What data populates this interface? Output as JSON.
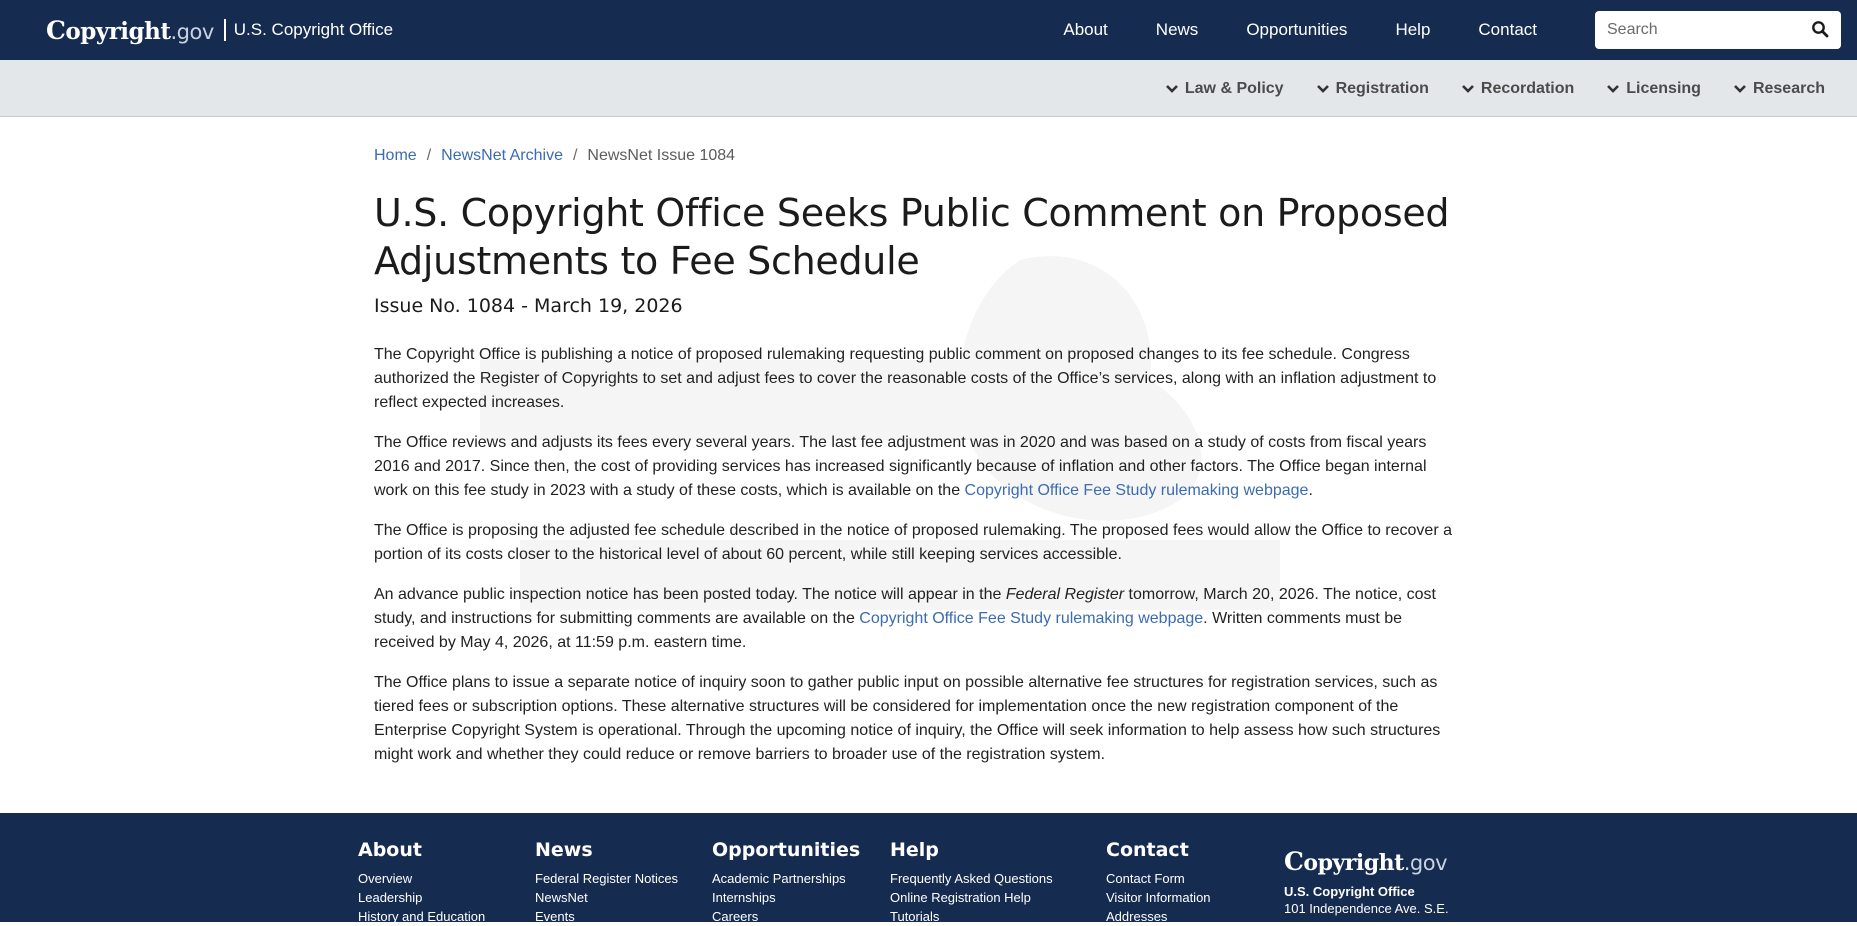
{
  "header": {
    "logo_main": "opyright",
    "logo_c": "C",
    "logo_gov": ".gov",
    "office": "U.S. Copyright Office",
    "nav": [
      "About",
      "News",
      "Opportunities",
      "Help",
      "Contact"
    ],
    "search_placeholder": "Search"
  },
  "subnav": [
    "Law & Policy",
    "Registration",
    "Recordation",
    "Licensing",
    "Research"
  ],
  "breadcrumb": {
    "home": "Home",
    "archive": "NewsNet Archive",
    "current": "NewsNet Issue 1084"
  },
  "article": {
    "title": "U.S. Copyright Office Seeks Public Comment on Proposed Adjustments to Fee Schedule",
    "issue": "Issue No. 1084 - March 19, 2026",
    "p1": "The Copyright Office is publishing a notice of proposed rulemaking requesting public comment on proposed changes to its fee schedule. Congress authorized the Register of Copyrights to set and adjust fees to cover the reasonable costs of the Office’s services, along with an inflation adjustment to reflect expected increases.",
    "p2_a": "The Office reviews and adjusts its fees every several years. The last fee adjustment was in 2020 and was based on a study of costs from fiscal years 2016 and 2017. Since then, the cost of providing services has increased significantly because of inflation and other factors. The Office began internal work on this fee study in 2023 with a study of these costs, which is available on the ",
    "p2_link": "Copyright Office Fee Study rulemaking webpage",
    "p2_b": ".",
    "p3": "The Office is proposing the adjusted fee schedule described in the notice of proposed rulemaking. The proposed fees would allow the Office to recover a portion of its costs closer to the historical level of about 60 percent, while still keeping services accessible.",
    "p4_a": "An advance public inspection notice has been posted today. The notice will appear in the ",
    "p4_em": "Federal Register",
    "p4_b": " tomorrow, March 20, 2026. The notice, cost study, and instructions for submitting comments are available on the ",
    "p4_link": "Copyright Office Fee Study rulemaking webpage",
    "p4_c": ". Written comments must be received by May 4, 2026, at 11:59 p.m. eastern time.",
    "p5": "The Office plans to issue a separate notice of inquiry soon to gather public input on possible alternative fee structures for registration services, such as tiered fees or subscription options. These alternative structures will be considered for implementation once the new registration component of the Enterprise Copyright System is operational. Through the upcoming notice of inquiry, the Office will seek information to help assess how such structures might work and whether they could reduce or remove barriers to broader use of the registration system."
  },
  "footer": {
    "columns": [
      {
        "heading": "About",
        "links": [
          "Overview",
          "Leadership",
          "History and Education"
        ]
      },
      {
        "heading": "News",
        "links": [
          "Federal Register Notices",
          "NewsNet",
          "Events"
        ]
      },
      {
        "heading": "Opportunities",
        "links": [
          "Academic Partnerships",
          "Internships",
          "Careers"
        ]
      },
      {
        "heading": "Help",
        "links": [
          "Frequently Asked Questions",
          "Online Registration Help",
          "Tutorials"
        ]
      },
      {
        "heading": "Contact",
        "links": [
          "Contact Form",
          "Visitor Information",
          "Addresses"
        ]
      }
    ],
    "office": "U.S. Copyright Office",
    "address": "101 Independence Ave. S.E."
  },
  "colors": {
    "navy": "#152b4f",
    "subbar": "#e4e7ea",
    "link": "#3b6cb0"
  }
}
